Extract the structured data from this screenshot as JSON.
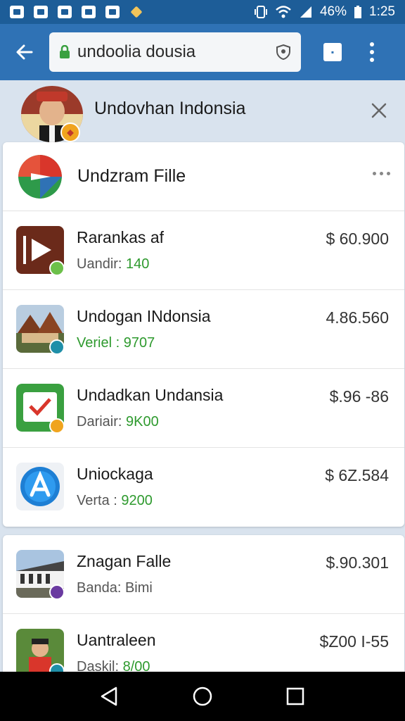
{
  "status": {
    "battery": "46%",
    "time": "1:25"
  },
  "browser": {
    "url": "undoolia dousia"
  },
  "profile": {
    "name": "Undovhan Indonsia"
  },
  "card": {
    "title": "Undzram Fille",
    "items": [
      {
        "title": "Rarankas af",
        "sub_label": "Uandir:",
        "sub_value": "140",
        "price": "$ 60.900"
      },
      {
        "title": "Undogan INdonsia",
        "sub_label": "Veriel :",
        "sub_value": "9707",
        "price": "4.86.560"
      },
      {
        "title": "Undadkan Undansia",
        "sub_label": "Dariair:",
        "sub_value": "9K00",
        "price": "$.96 -86"
      },
      {
        "title": "Uniockaga",
        "sub_label": "Verta :",
        "sub_value": "9200",
        "price": "$ 6Z.584"
      }
    ]
  },
  "card2": {
    "items": [
      {
        "title": "Znagan Falle",
        "sub_label": "Banda: Bimi",
        "sub_value": "",
        "price": "$.90.301"
      },
      {
        "title": "Uantraleen",
        "sub_label": "Daskil:",
        "sub_value": "8/00",
        "price": "$Z00 I-55"
      }
    ]
  },
  "colors": {
    "status_bar": "#1d5d98",
    "app_bar": "#2f72b5",
    "accent_green": "#2e9a2e"
  }
}
